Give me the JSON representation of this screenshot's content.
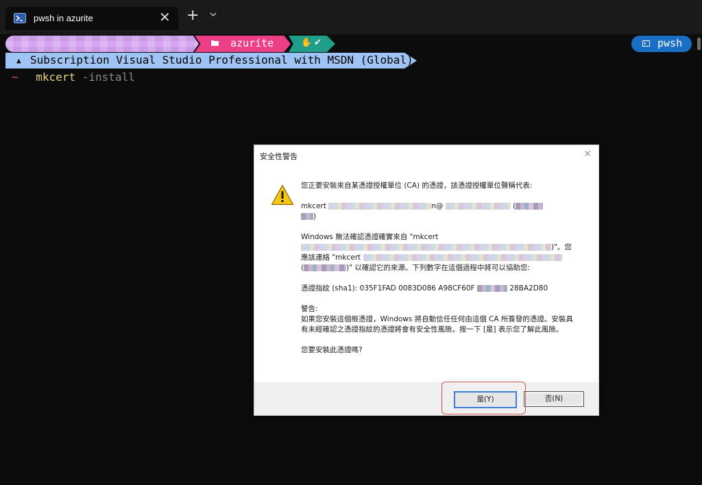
{
  "tab": {
    "title": "pwsh in azurite",
    "close": "✕",
    "new_tab": "+"
  },
  "prompt": {
    "dir": "azurite",
    "git_check": "✔",
    "shell": "pwsh",
    "subscription": "Subscription Visual Studio Professional with MSDN (Global)",
    "tilde": "~",
    "command": "mkcert",
    "argument": "-install"
  },
  "dialog": {
    "title": "安全性警告",
    "close": "✕",
    "p1": "您正要安裝來自某憑證授權單位 (CA) 的憑證，該憑證授權單位聲稱代表:",
    "p2_prefix": "mkcert",
    "p2_at": "n@",
    "p2_paren": "(",
    "p2_end": ")",
    "p3_line1": "Windows 無法確認憑證確實來自 \"mkcert",
    "p3_quote_end": ")\"。您",
    "p3_line3_prefix": "應該連絡 \"mkcert",
    "p3_line4_prefix": "(",
    "p3_line4_suffix": ")\" 以確認它的來源。下列數字在這個過程中將可以協助您:",
    "thumb_prefix": "憑證指紋 (sha1): 035F1FAD 0083D086 A98CF60F",
    "thumb_suffix": "28BA2D80",
    "warn_label": "警告:",
    "warn_text": "如果您安裝這個根憑證，Windows 將自動信任任何由這個 CA 所簽發的憑證。安裝具有未經確認之憑證指紋的憑證將會有安全性風險。按一下 [是] 表示您了解此風險。",
    "question": "您要安裝此憑證嗎?",
    "yes": "是(Y)",
    "no": "否(N)"
  },
  "colors": {
    "background": "#0c0c0c",
    "segment_user": "#d6a7f0",
    "segment_dir": "#ec3f88",
    "segment_git": "#1f9e89",
    "segment_shell": "#1a6fc4",
    "subscription": "#9ec4f5",
    "highlight": "#d9534f"
  }
}
